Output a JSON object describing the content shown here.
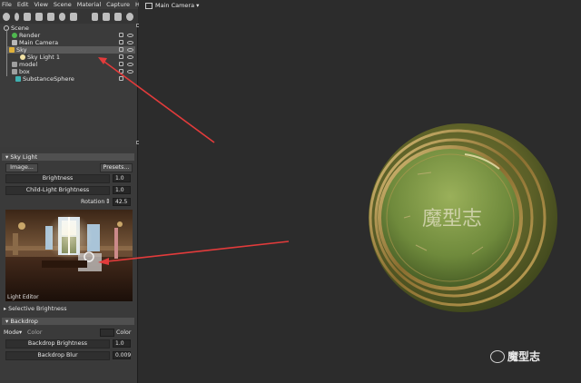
{
  "menu": [
    "File",
    "Edit",
    "View",
    "Scene",
    "Material",
    "Capture",
    "Help"
  ],
  "viewport": {
    "camera_label": "Main Camera"
  },
  "tree": {
    "scene": "Scene",
    "render": "Render",
    "main_camera": "Main Camera",
    "sky": "Sky",
    "sky_light": "Sky Light 1",
    "model": "model",
    "box": "box",
    "sphere": "SubstanceSphere"
  },
  "sky_light": {
    "header": "Sky Light",
    "image_btn": "Image...",
    "presets_btn": "Presets...",
    "brightness_label": "Brightness",
    "brightness_value": "1.0",
    "child_label": "Child-Light Brightness",
    "child_value": "1.0",
    "rotation_label": "Rotation",
    "rotation_value": "42.5",
    "light_editor": "Light Editor",
    "selective": "Selective Brightness"
  },
  "backdrop": {
    "header": "Backdrop",
    "mode_label": "Mode",
    "mode_value": "Color",
    "color_label": "Color",
    "brightness_label": "Backdrop Brightness",
    "brightness_value": "1.0",
    "blur_label": "Backdrop Blur",
    "blur_value": "0.009"
  },
  "sphere_engraving": "魔型志",
  "watermark": "魔型志",
  "colors": {
    "arrow": "#e23b3b",
    "selected_row": "#5a5a5a",
    "sphere_green": "#6f8a3c",
    "rim_gold": "#a4863d"
  }
}
